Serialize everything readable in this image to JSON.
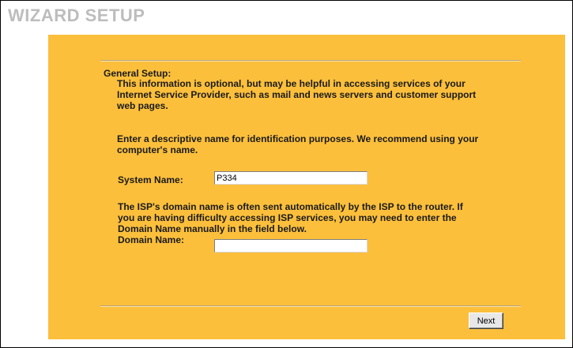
{
  "header": {
    "title": "WIZARD SETUP"
  },
  "general_setup": {
    "heading": "General Setup:",
    "intro_line1": "This information is optional, but may be helpful in accessing services of your",
    "intro_line2": "Internet Service Provider, such as mail and news servers and customer support",
    "intro_line3": "web pages.",
    "name_hint_line1": "Enter a descriptive name for identification purposes. We recommend using your",
    "name_hint_line2": "computer's name.",
    "system_name_label": "System Name:",
    "system_name_value": "P334",
    "domain_hint_line1": "The ISP's domain name is often sent automatically by the ISP to the router. If",
    "domain_hint_line2": "you are having difficulty accessing ISP services, you may need to enter the",
    "domain_hint_line3": "Domain Name manually in the field below.",
    "domain_name_label": "Domain Name:",
    "domain_name_value": ""
  },
  "footer": {
    "next_label": "Next"
  },
  "colors": {
    "panel_background": "#fbbf3c",
    "title_color": "#bdbdbd"
  }
}
